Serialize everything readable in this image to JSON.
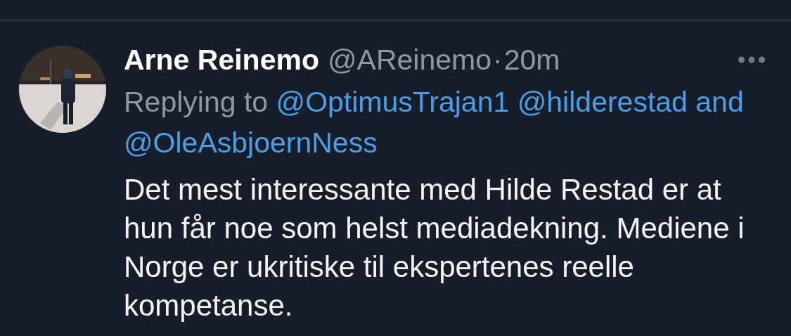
{
  "tweet": {
    "author_name": "Arne Reinemo",
    "handle": "@AReinemo",
    "separator": "·",
    "time": "20m",
    "reply": {
      "prefix": "Replying to",
      "mentions": [
        "@OptimusTrajan1",
        "@hilderestad"
      ],
      "conjunction": "and",
      "last_mention": "@OleAsbjoernNess"
    },
    "text": "Det mest interessante med Hilde Restad er at hun får noe som helst mediadekning. Mediene i Norge er ukritiske til ekspertenes reelle kompetanse."
  }
}
